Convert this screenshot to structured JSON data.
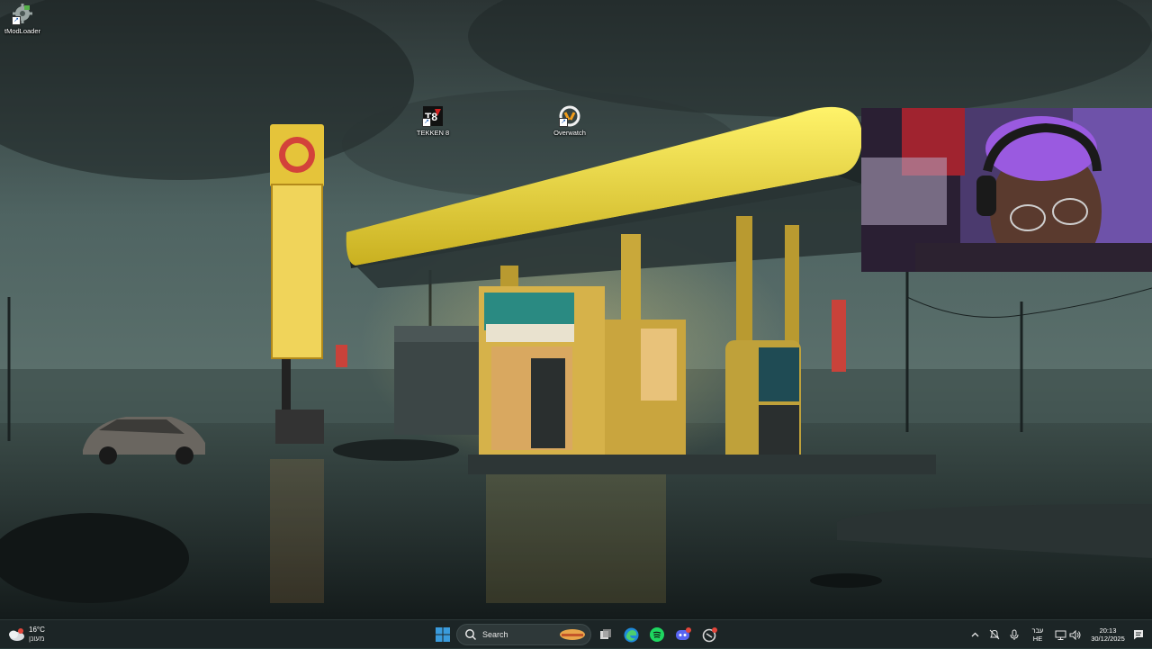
{
  "desktop": {
    "icons": [
      {
        "label": "tModLoader",
        "icon": "tmodloader-icon"
      },
      {
        "label": "TEKKEN 8",
        "icon": "tekken-icon"
      },
      {
        "label": "Overwatch",
        "icon": "overwatch-icon"
      }
    ],
    "wallpaper": "gas-station-rain-wallpaper"
  },
  "webcam": {
    "icon": "webcam-overlay"
  },
  "taskbar": {
    "weather": {
      "temp": "16°C",
      "condition": "מעונן",
      "icon": "cloud-icon"
    },
    "start_icon": "windows-start-icon",
    "search": {
      "label": "Search",
      "icon": "search-icon"
    },
    "pinned": [
      {
        "name": "search-highlight",
        "icon": "highlight-icon"
      },
      {
        "name": "task-view",
        "icon": "task-view-icon"
      },
      {
        "name": "edge",
        "icon": "edge-icon"
      },
      {
        "name": "spotify",
        "icon": "spotify-icon"
      },
      {
        "name": "discord",
        "icon": "discord-icon"
      },
      {
        "name": "other-app",
        "icon": "app-icon"
      }
    ],
    "tray": {
      "language_top": "עבר",
      "language_bottom": "HE",
      "time": "20:13",
      "date": "30/12/2025"
    },
    "colors": {
      "taskbar_bg": "#1c2526",
      "accent": "#3a9bdc"
    }
  }
}
